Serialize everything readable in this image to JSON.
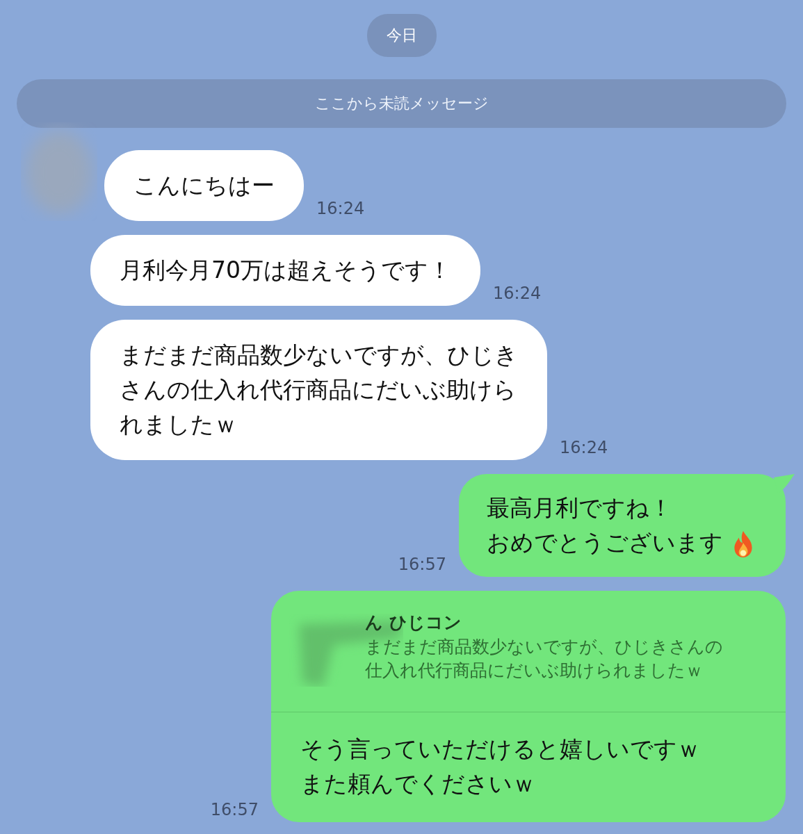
{
  "date_chip": "今日",
  "unread_divider": "ここから未読メッセージ",
  "messages": [
    {
      "kind": "received",
      "avatar": true,
      "lines": [
        "こんにちはー"
      ],
      "time": "16:24"
    },
    {
      "kind": "received",
      "avatar": false,
      "lines": [
        "月利今月70万は超えそうです！"
      ],
      "time": "16:24"
    },
    {
      "kind": "received",
      "avatar": false,
      "lines": [
        "まだまだ商品数少ないですが、ひじき",
        "さんの仕入れ代行商品にだいぶ助けら",
        "れましたｗ"
      ],
      "time": "16:24"
    },
    {
      "kind": "sent",
      "emoji": true,
      "lines": [
        "最高月利ですね！",
        "おめでとうございます"
      ],
      "time": "16:57"
    },
    {
      "kind": "reply",
      "quote": {
        "sender": "ん ひじコン",
        "lines": [
          "まだまだ商品数少ないですが、ひじきさんの",
          "仕入れ代行商品にだいぶ助けられましたｗ"
        ]
      },
      "lines": [
        "そう言っていただけると嬉しいですｗ",
        "また頼んでくださいｗ"
      ],
      "time": "16:57"
    }
  ]
}
